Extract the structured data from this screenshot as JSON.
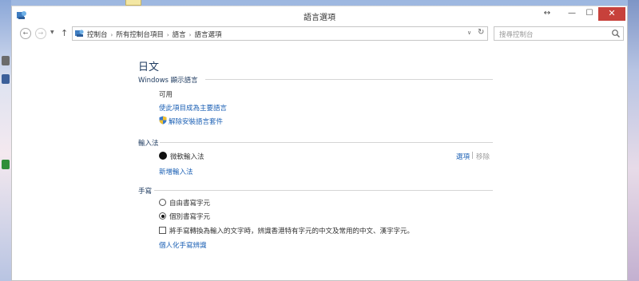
{
  "window": {
    "title": "語言選項",
    "close_glyph": "✕",
    "maximize_glyph": "☐",
    "minimize_glyph": "—",
    "resize_glyph": "↔"
  },
  "navigation": {
    "back_glyph": "←",
    "forward_glyph": "→",
    "recent_glyph": "▼",
    "up_glyph": "↑",
    "breadcrumbs": [
      "控制台",
      "所有控制台項目",
      "語言",
      "語言選項"
    ],
    "crumb_separator": "›",
    "dropdown_glyph": "∨",
    "refresh_glyph": "↻"
  },
  "search": {
    "placeholder": "搜尋控制台"
  },
  "language": {
    "title": "日文"
  },
  "windows_display_language": {
    "heading": "Windows 顯示語言",
    "status": "可用",
    "make_primary_link": "使此項目成為主要語言",
    "remove_pack_link": "解除安裝語言套件"
  },
  "input_method": {
    "heading": "輸入法",
    "name": "微軟輸入法",
    "options_link": "選項",
    "separator": "|",
    "remove_label": "移除",
    "add_link": "新增輸入法"
  },
  "handwriting": {
    "heading": "手寫",
    "option_freeform": "自由書寫字元",
    "option_single": "個別書寫字元",
    "selected": "option_single",
    "convert_checkbox_label": "將手寫轉換為輸入的文字時，辨識香港特有字元的中文及常用的中文、漢字字元。",
    "convert_checked": false,
    "personalize_link": "個人化手寫辨識"
  },
  "colors": {
    "link": "#1a5fb4",
    "heading": "#1e3a5f",
    "close_button": "#c7413b"
  }
}
